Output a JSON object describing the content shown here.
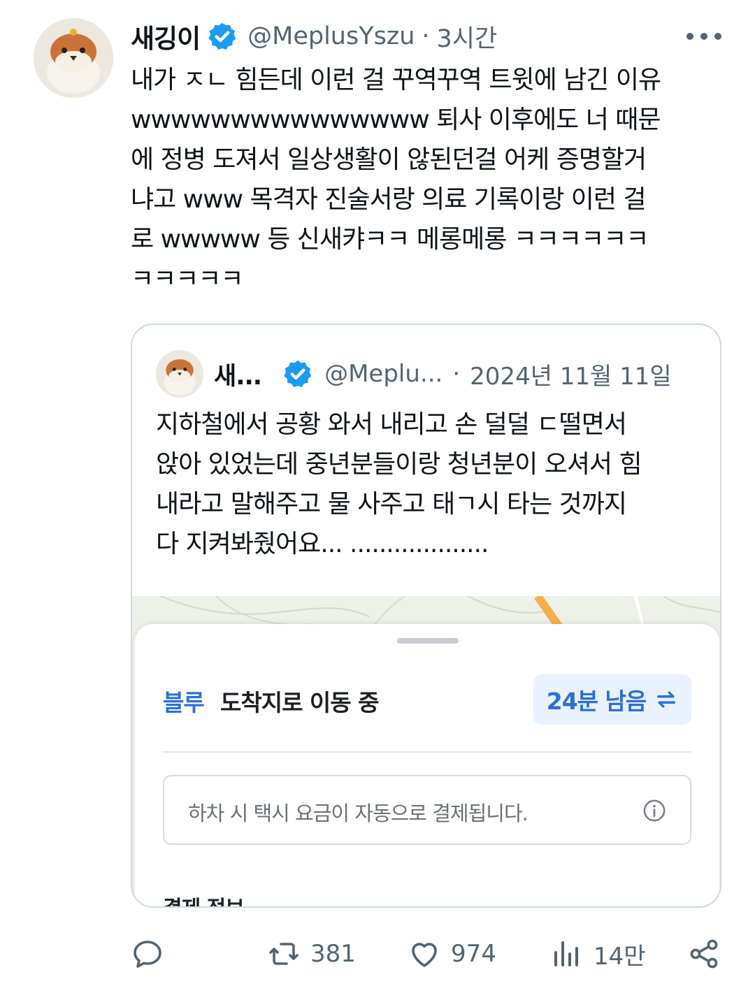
{
  "tweet": {
    "display_name": "새깅이",
    "handle": "@MeplusYszu",
    "separator": "·",
    "time": "3시간",
    "text": "내가 ㅈㄴ 힘든데 이런 걸 꾸역꾸역 트윗에 남긴 이유\nwwwwwwwwwwwwwww 퇴사 이후에도 너 때문\n에 정병 도져서 일상생활이 않된던걸 어케 증명할거\n냐고 www 목격자 진술서랑 의료 기록이랑 이런 걸\n로 wwwww 등 신새캬ㅋㅋ 메롱메롱 ㅋㅋㅋㅋㅋㅋ\nㅋㅋㅋㅋㅋ"
  },
  "quote": {
    "display_name": "새...",
    "handle": "@Meplu...",
    "separator": "·",
    "date": "2024년 11월 11일",
    "text": "지하철에서 공황 와서 내리고 손 덜덜 ㄷ떨면서\n앉아 있었는데 중년분들이랑 청년분이 오셔서 힘\n내라고 말해주고 물 사주고 태ㄱ시 타는 것까지\n다 지켜봐줬어요... ...................",
    "attached_screenshot": {
      "status_accent": "블루",
      "status_text": "도착지로 이동 중",
      "eta": "24분 남음",
      "notice": "하차 시 택시 요금이 자동으로 결제됩니다.",
      "section_label": "결제 정보",
      "accent_color": "#2d6fd6"
    }
  },
  "actions": {
    "reply_count": "",
    "retweet_count": "381",
    "like_count": "974",
    "view_count": "14만"
  },
  "icons": [
    "verified-badge-icon",
    "more-icon",
    "swap-icon",
    "info-icon",
    "reply-icon",
    "retweet-icon",
    "like-icon",
    "views-icon",
    "share-icon"
  ],
  "colors": {
    "verified": "#1d9bf0",
    "secondary_text": "#536471",
    "border": "#cfd9de"
  }
}
